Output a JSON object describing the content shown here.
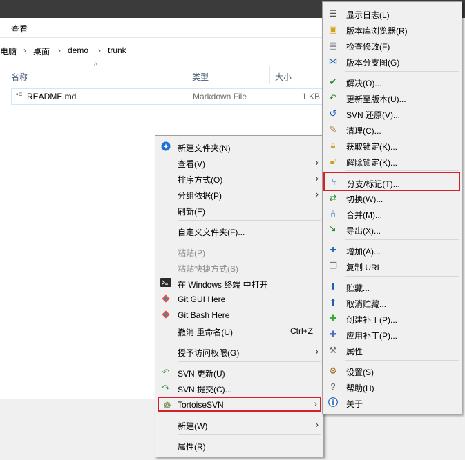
{
  "explorer": {
    "ribbon_tab": "查看",
    "breadcrumb": [
      "电脑",
      "桌面",
      "demo",
      "trunk"
    ],
    "columns": {
      "name": "名称",
      "type": "类型",
      "size": "大小"
    },
    "file": {
      "name": "README.md",
      "type": "Markdown File",
      "size": "1 KB"
    }
  },
  "context_menu": {
    "items": [
      {
        "label": "新建文件夹(N)",
        "icon": "new-folder-icon"
      },
      {
        "label": "查看(V)"
      },
      {
        "label": "排序方式(O)"
      },
      {
        "label": "分组依据(P)"
      },
      {
        "label": "刷新(E)"
      },
      {
        "label": "自定义文件夹(F)..."
      },
      {
        "label": "粘贴(P)"
      },
      {
        "label": "粘贴快捷方式(S)"
      },
      {
        "label": "在 Windows 终端 中打开",
        "icon": "terminal-icon"
      },
      {
        "label": "Git GUI Here",
        "icon": "git-icon"
      },
      {
        "label": "Git Bash Here",
        "icon": "git-icon"
      },
      {
        "label": "撤消 重命名(U)",
        "shortcut": "Ctrl+Z"
      },
      {
        "label": "授予访问权限(G)"
      },
      {
        "label": "SVN 更新(U)",
        "icon": "svn-update-icon"
      },
      {
        "label": "SVN 提交(C)...",
        "icon": "svn-commit-icon"
      },
      {
        "label": "TortoiseSVN",
        "icon": "tortoise-icon"
      },
      {
        "label": "新建(W)"
      },
      {
        "label": "属性(R)"
      }
    ]
  },
  "svn_menu": {
    "items": [
      {
        "label": "显示日志(L)",
        "icon": "log-icon"
      },
      {
        "label": "版本库浏览器(R)",
        "icon": "repo-browser-icon"
      },
      {
        "label": "检查修改(F)",
        "icon": "check-modifications-icon"
      },
      {
        "label": "版本分支图(G)",
        "icon": "revision-graph-icon"
      },
      {
        "label": "解决(O)...",
        "icon": "resolve-icon"
      },
      {
        "label": "更新至版本(U)...",
        "icon": "update-to-revision-icon"
      },
      {
        "label": "SVN 还原(V)...",
        "icon": "revert-icon"
      },
      {
        "label": "清理(C)...",
        "icon": "cleanup-icon"
      },
      {
        "label": "获取锁定(K)...",
        "icon": "lock-icon"
      },
      {
        "label": "解除锁定(K)...",
        "icon": "unlock-icon"
      },
      {
        "label": "分支/标记(T)...",
        "icon": "branch-icon"
      },
      {
        "label": "切换(W)...",
        "icon": "switch-icon"
      },
      {
        "label": "合并(M)...",
        "icon": "merge-icon"
      },
      {
        "label": "导出(X)...",
        "icon": "export-icon"
      },
      {
        "label": "增加(A)...",
        "icon": "add-icon"
      },
      {
        "label": "复制 URL",
        "icon": "copy-url-icon"
      },
      {
        "label": "贮藏...",
        "icon": "shelve-icon"
      },
      {
        "label": "取消贮藏...",
        "icon": "unshelve-icon"
      },
      {
        "label": "创建补丁(P)...",
        "icon": "create-patch-icon"
      },
      {
        "label": "应用补丁(P)...",
        "icon": "apply-patch-icon"
      },
      {
        "label": "属性",
        "icon": "properties-icon"
      },
      {
        "label": "设置(S)",
        "icon": "settings-icon"
      },
      {
        "label": "帮助(H)",
        "icon": "help-icon"
      },
      {
        "label": "关于",
        "icon": "about-icon"
      }
    ]
  },
  "colors": {
    "highlight": "#d4202a",
    "svn_green": "#2e8b2e",
    "svn_blue": "#1a5fb4"
  }
}
